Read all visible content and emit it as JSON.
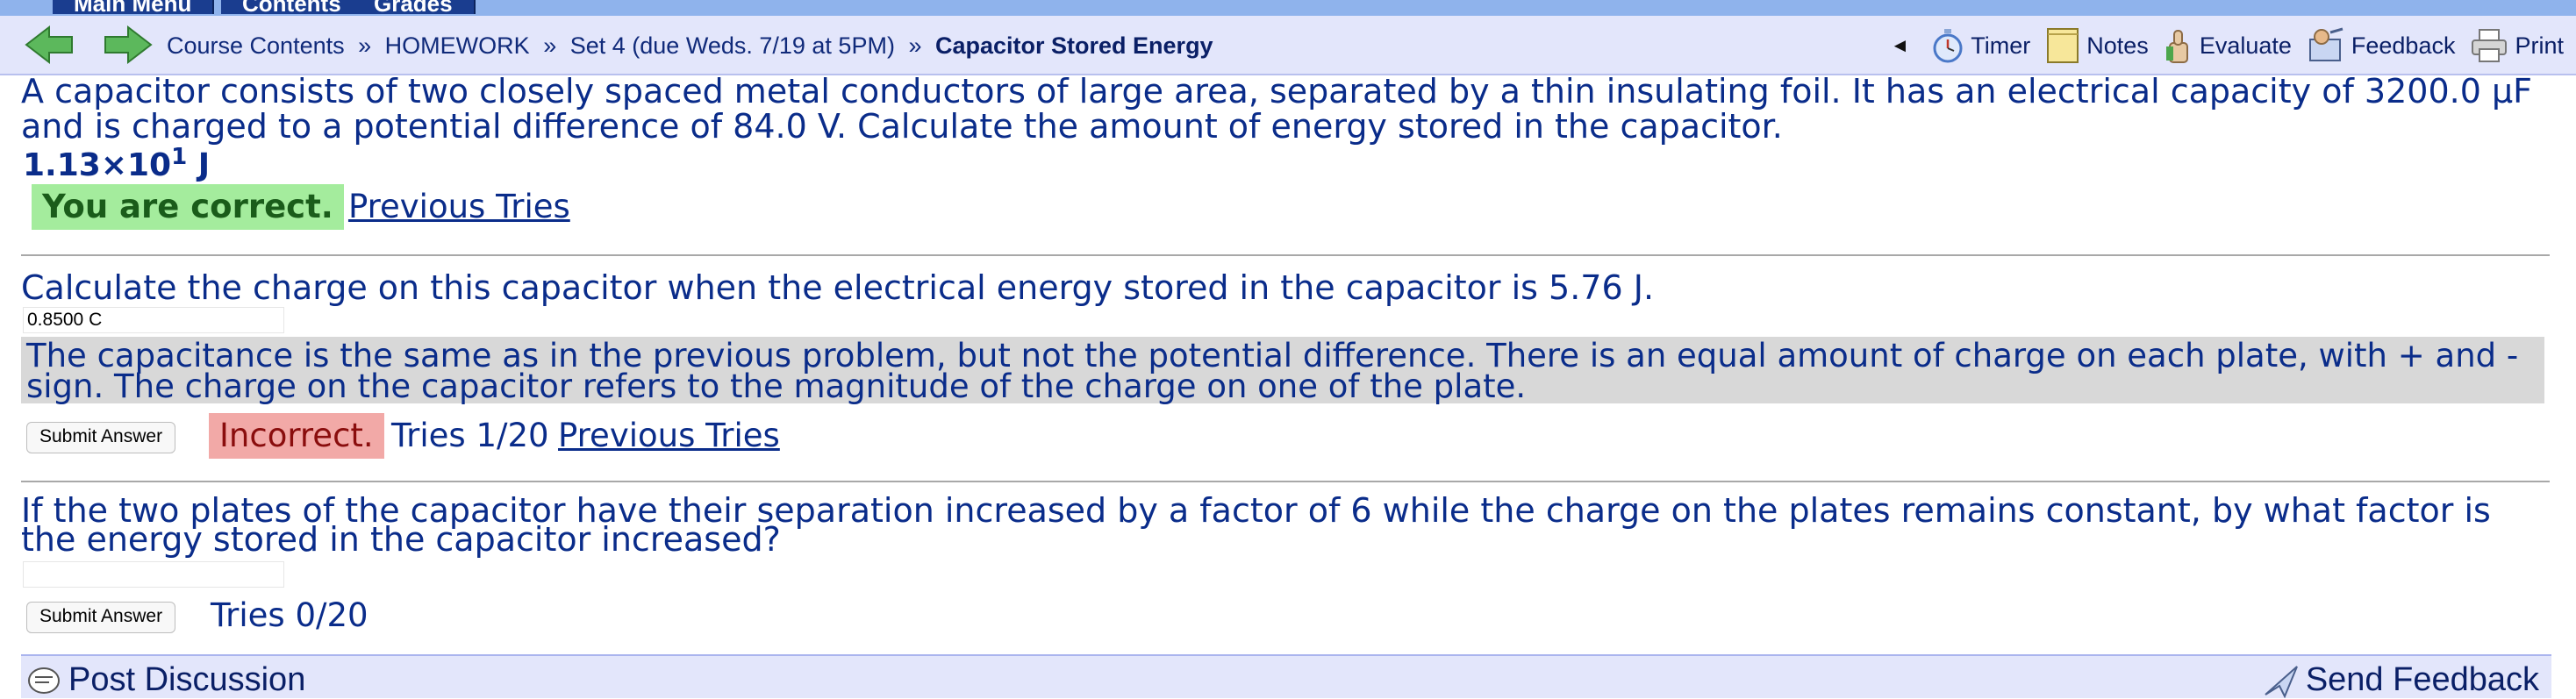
{
  "tabs": [
    "Main Menu",
    "Contents",
    "Grades"
  ],
  "breadcrumb": {
    "items": [
      "Course Contents",
      "HOMEWORK",
      "Set 4 (due Weds. 7/19 at 5PM)"
    ],
    "separator": "»",
    "current": "Capacitor Stored Energy"
  },
  "tools": {
    "collapse": "◄",
    "timer": "Timer",
    "notes": "Notes",
    "evaluate": "Evaluate",
    "feedback": "Feedback",
    "print": "Print"
  },
  "problem1": {
    "text": "A capacitor consists of two closely spaced metal conductors of large area, separated by a thin insulating foil. It has an electrical capacity of 3200.0 μF and is charged to a potential difference of 84.0 V. Calculate the amount of energy stored in the capacitor.",
    "answer_mantissa": "1.13×10",
    "answer_exponent": "1",
    "answer_unit": " J",
    "status": "You are correct.",
    "previous_tries": "Previous Tries"
  },
  "problem2": {
    "text": "Calculate the charge on this capacitor when the electrical energy stored in the capacitor is 5.76 J.",
    "input_value": "0.8500 C",
    "hint": "The capacitance is the same as in the previous problem, but not the potential difference. There is an equal amount of charge on each plate, with + and - sign. The charge on the capacitor refers to the magnitude of the charge on one of the plate.",
    "submit": "Submit Answer",
    "status": "Incorrect.",
    "tries": "Tries 1/20",
    "previous_tries": "Previous Tries"
  },
  "problem3": {
    "text": "If the two plates of the capacitor have their separation increased by a factor of 6 while the charge on the plates remains constant, by what factor is the energy stored in the capacitor increased?",
    "input_value": "",
    "submit": "Submit Answer",
    "tries": "Tries 0/20"
  },
  "footer": {
    "post_discussion": "Post Discussion",
    "send_feedback": "Send Feedback"
  },
  "colors": {
    "nav_bg": "#e3e6fb",
    "text_blue": "#0a2c8a",
    "correct_bg": "#a4ec9d",
    "incorrect_bg": "#f2a9a7",
    "hint_bg": "#d8d8d8",
    "arrow_green": "#5cb85c"
  },
  "icons": [
    "back-arrow-icon",
    "forward-arrow-icon",
    "timer-icon",
    "notes-icon",
    "evaluate-icon",
    "feedback-icon",
    "print-icon",
    "discussion-icon",
    "send-feedback-icon"
  ]
}
